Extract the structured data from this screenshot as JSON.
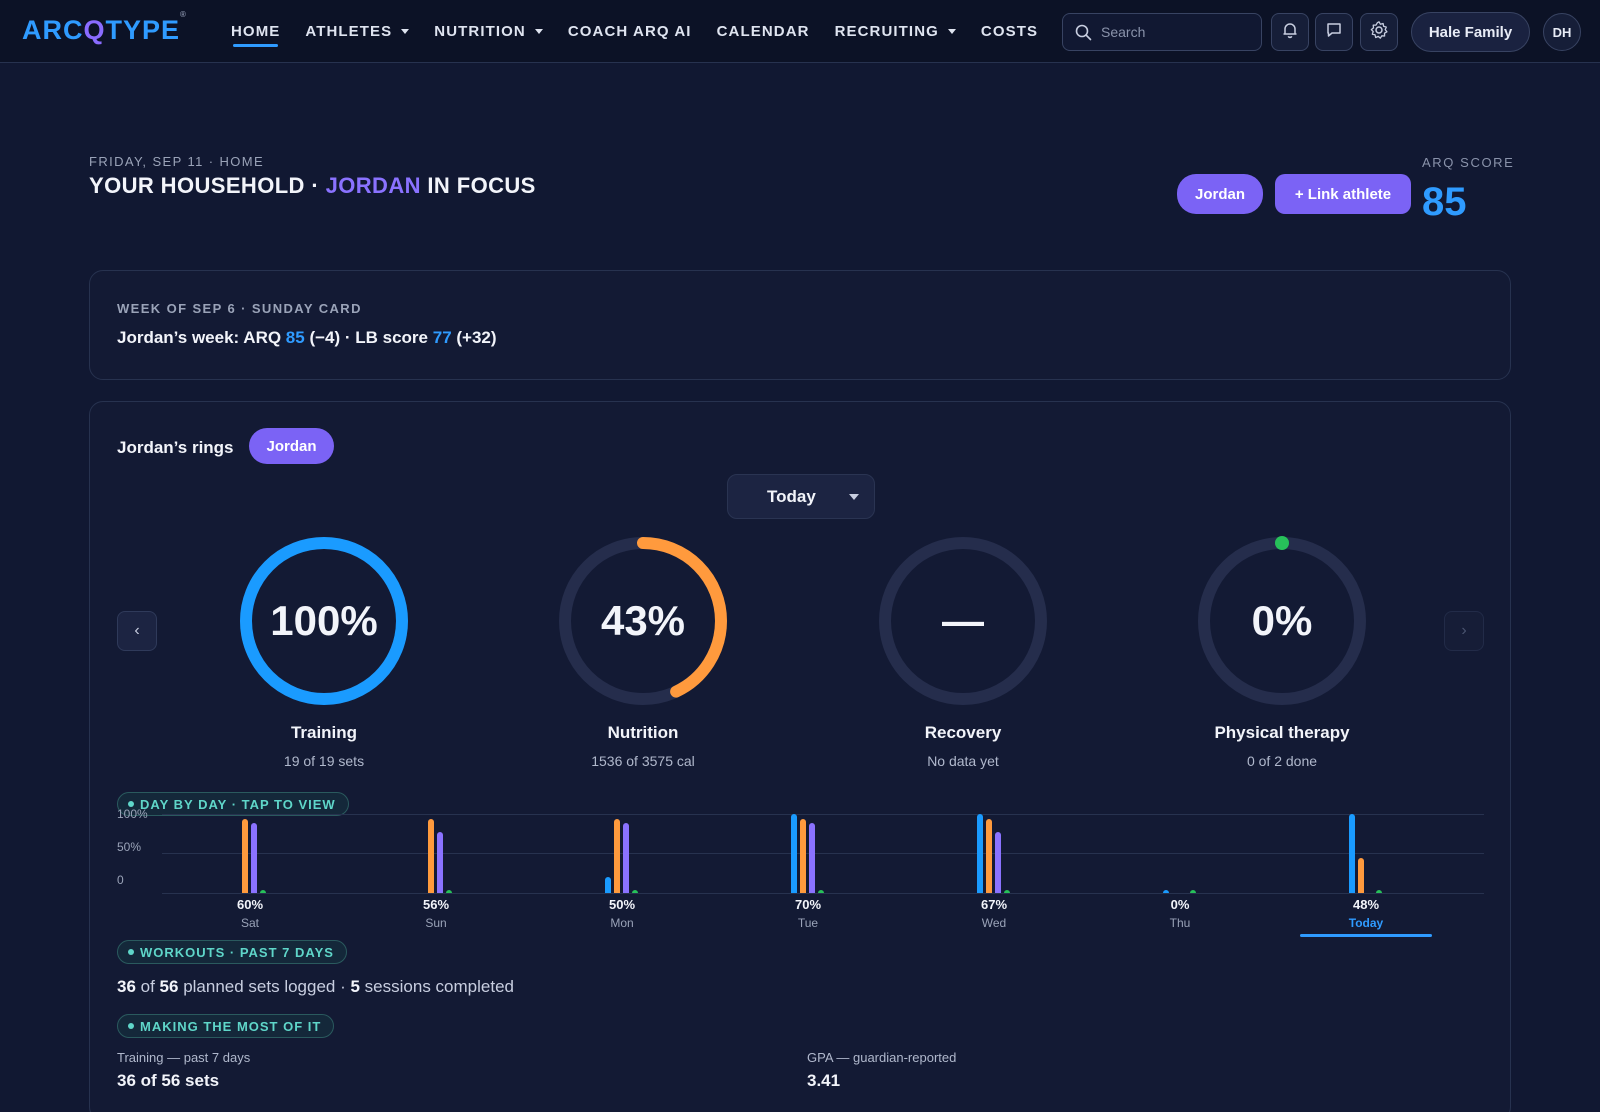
{
  "nav": {
    "logo_a": "ARC",
    "logo_o": "Q",
    "logo_b": "TYPE",
    "logo_mark": "®",
    "links": [
      {
        "label": "HOME",
        "active": true
      },
      {
        "label": "ATHLETES",
        "dropdown": true
      },
      {
        "label": "NUTRITION",
        "dropdown": true
      },
      {
        "label": "COACH ARQ AI"
      },
      {
        "label": "CALENDAR"
      },
      {
        "label": "RECRUITING",
        "dropdown": true
      },
      {
        "label": "COSTS"
      }
    ],
    "search_placeholder": "Search",
    "icons": [
      "bell-icon",
      "chat-icon",
      "gear-icon"
    ],
    "family_label": "Hale Family",
    "avatar_initials": "DH"
  },
  "header": {
    "eyebrow": "FRIDAY, SEP 11 · HOME",
    "title_pre": "YOUR HOUSEHOLD · ",
    "title_name": "JORDAN",
    "title_post": " IN FOCUS",
    "athlete_pill": "Jordan",
    "link_button": "+ Link athlete",
    "arq_label": "ARQ SCORE",
    "arq_value": "85"
  },
  "sunday_card": {
    "label": "WEEK OF SEP 6 · SUNDAY CARD",
    "pre": "Jordan’s week: ARQ ",
    "arq": "85",
    "arq_delta": " (−4) · LB score ",
    "lb": "77",
    "lb_delta": " (+32)"
  },
  "rings_card": {
    "title": "Jordan’s rings",
    "pill": "Jordan",
    "period": "Today",
    "prev_arrow": "‹",
    "next_arrow": "›",
    "rings": [
      {
        "name": "Training",
        "pct": "100%",
        "sub": "19 of 19 sets",
        "value": 1.0,
        "color": "#1a9bff"
      },
      {
        "name": "Nutrition",
        "pct": "43%",
        "sub": "1536 of 3575 cal",
        "value": 0.43,
        "color": "#ff9a3d"
      },
      {
        "name": "Recovery",
        "pct": "—",
        "sub": "No data yet",
        "value": 0,
        "color": "#8a72ff"
      },
      {
        "name": "Physical therapy",
        "pct": "0%",
        "sub": "0 of 2 done",
        "value": 0,
        "color": "#27c15a"
      }
    ],
    "day_tag": "DAY BY DAY · TAP TO VIEW",
    "workouts_tag": "WORKOUTS · PAST 7 DAYS",
    "workouts": {
      "logged": "36",
      "of_text": " of ",
      "planned": "56",
      "mid_text": " planned sets logged · ",
      "sessions": "5",
      "end_text": " sessions completed"
    },
    "most_tag": "MAKING THE MOST OF IT",
    "stats": [
      {
        "label": "Training — past 7 days",
        "value": "36 of 56 sets"
      },
      {
        "label": "GPA — guardian-reported",
        "value": "3.41"
      }
    ]
  },
  "chart_data": {
    "type": "bar",
    "title": "",
    "ylim": [
      0,
      100
    ],
    "yticks": [
      "100%",
      "50%",
      "0"
    ],
    "categories": [
      "Sat",
      "Sun",
      "Mon",
      "Tue",
      "Wed",
      "Thu",
      "Today"
    ],
    "day_pct_labels": [
      "60%",
      "56%",
      "50%",
      "70%",
      "67%",
      "0%",
      "48%"
    ],
    "selected": "Today",
    "series": [
      {
        "color": "#1a9bff",
        "values": [
          0,
          0,
          20,
          100,
          100,
          3,
          100
        ]
      },
      {
        "color": "#ff9a3d",
        "values": [
          94,
          94,
          94,
          94,
          94,
          0,
          44
        ]
      },
      {
        "color": "#8a72ff",
        "values": [
          89,
          77,
          89,
          89,
          77,
          0,
          0
        ]
      },
      {
        "color": "#27c15a",
        "values": [
          3,
          3,
          3,
          3,
          3,
          3,
          3
        ]
      }
    ]
  }
}
